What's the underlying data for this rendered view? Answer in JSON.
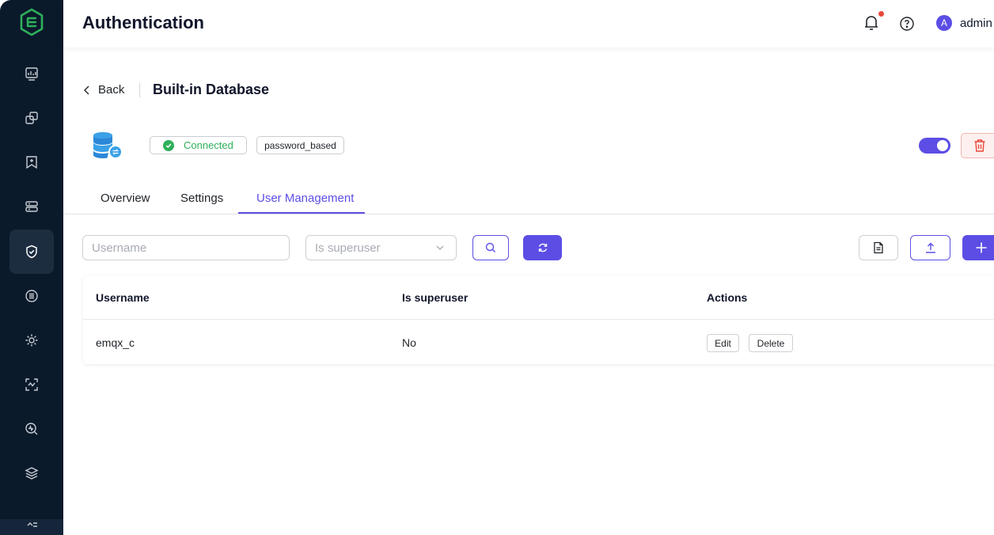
{
  "header": {
    "title": "Authentication",
    "user_initial": "A",
    "user_name": "admin"
  },
  "breadcrumb": {
    "back_label": "Back",
    "title": "Built-in Database"
  },
  "info": {
    "status": "Connected",
    "mechanism": "password_based",
    "enabled": true
  },
  "tabs": [
    {
      "label": "Overview",
      "active": false
    },
    {
      "label": "Settings",
      "active": false
    },
    {
      "label": "User Management",
      "active": true
    }
  ],
  "filters": {
    "username_placeholder": "Username",
    "superuser_placeholder": "Is superuser"
  },
  "table": {
    "columns": [
      "Username",
      "Is superuser",
      "Actions"
    ],
    "rows": [
      {
        "username": "emqx_c",
        "is_superuser": "No",
        "edit_label": "Edit",
        "delete_label": "Delete"
      }
    ]
  },
  "colors": {
    "accent": "#5c4ee5",
    "sidebar": "#0b1a2b",
    "success": "#2eb05b",
    "danger": "#e8483b"
  },
  "icons": {
    "sidebar": [
      "dashboard-icon",
      "connections-icon",
      "subscriptions-icon",
      "data-integration-icon",
      "access-control-icon",
      "topics-icon",
      "management-icon",
      "monitoring-icon",
      "diagnose-icon",
      "extensions-icon"
    ]
  }
}
